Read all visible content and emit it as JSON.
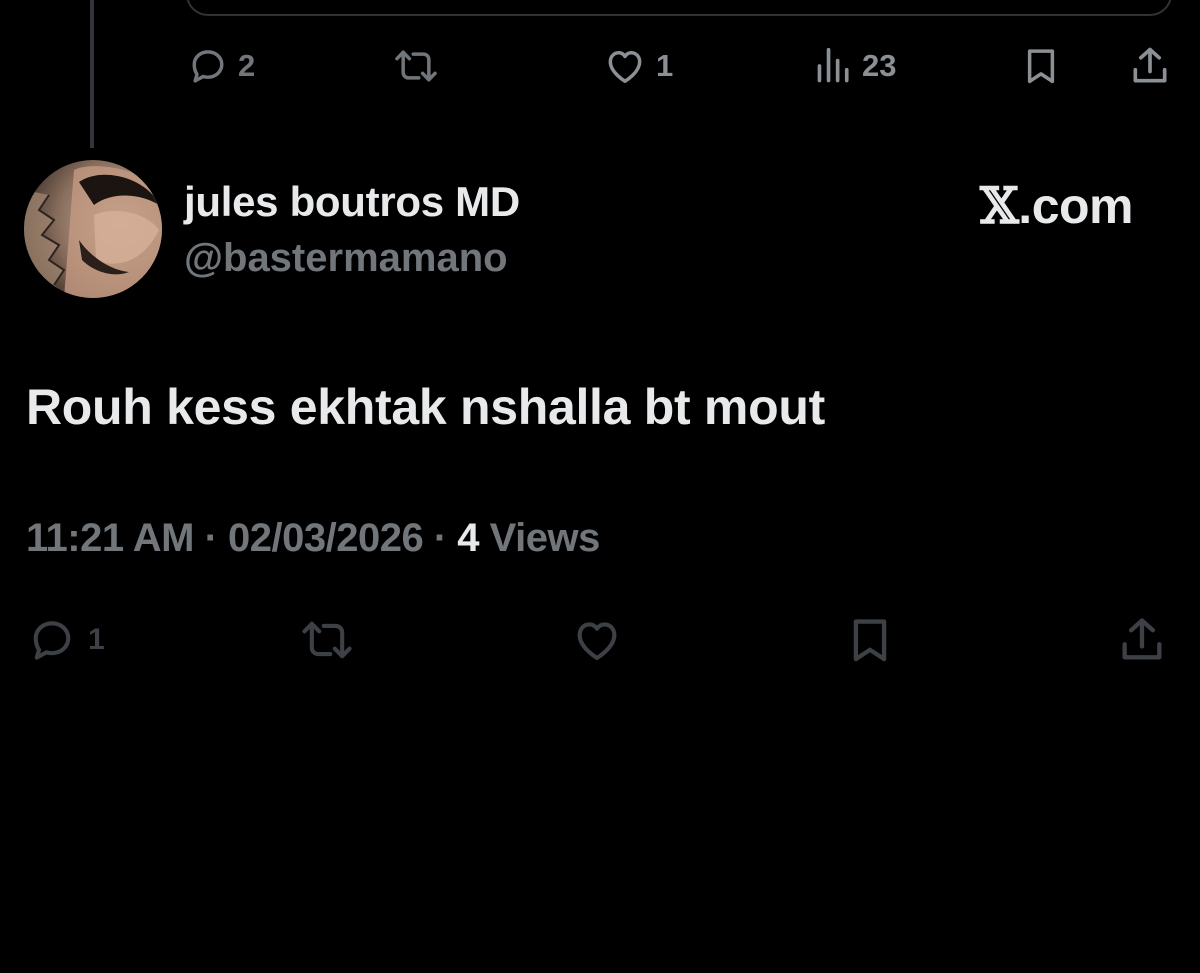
{
  "previous_tweet": {
    "actions": {
      "reply_count": "2",
      "like_count": "1",
      "view_count": "23"
    }
  },
  "tweet": {
    "author": {
      "display_name": "jules boutros MD",
      "handle": "@bastermamano"
    },
    "site_mark": {
      "glyph": "𝕏",
      "text": ".com"
    },
    "text": "Rouh kess ekhtak nshalla bt mout",
    "meta": {
      "time": "11:21 AM",
      "separator": "·",
      "date": "02/03/2026",
      "views_count": "4",
      "views_label": "Views"
    },
    "actions": {
      "reply_count": "1"
    }
  },
  "icons": {
    "reply": "speech-bubble-icon",
    "repost": "repost-arrows-icon",
    "like": "heart-icon",
    "views": "bar-chart-icon",
    "bookmark": "bookmark-icon",
    "share": "share-upload-icon"
  },
  "colors": {
    "background": "#000000",
    "primary_text": "#e7e9ea",
    "secondary_text": "#71767b",
    "dim_action": "#3d4145",
    "divider": "#2f3336"
  }
}
